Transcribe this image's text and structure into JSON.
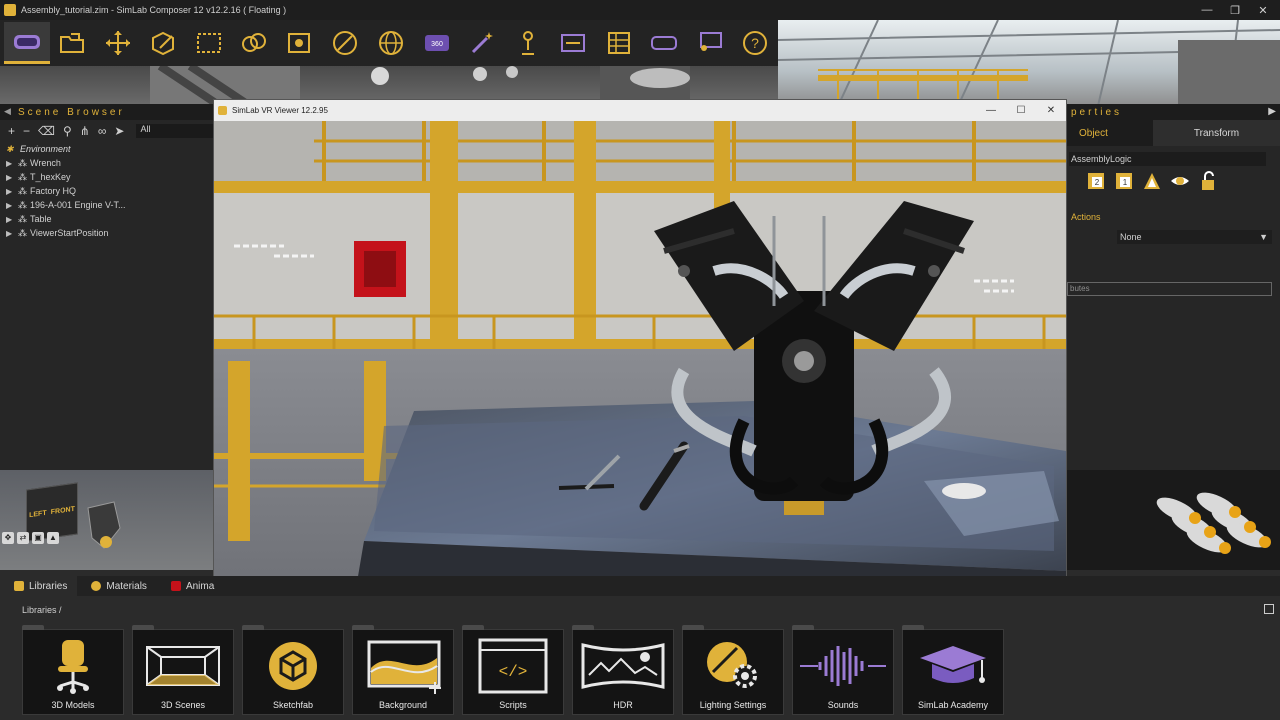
{
  "window": {
    "title": "Assembly_tutorial.zim - SimLab Composer 12 v12.2.16 ( Floating )",
    "controls": {
      "minimize": "—",
      "maximize": "❐",
      "close": "✕"
    }
  },
  "toolbar": {
    "tools": [
      "vr-headset-icon",
      "open-folder-icon",
      "move-icon",
      "edit-cube-icon",
      "selection-rect-icon",
      "pattern-icon",
      "camera-frame-icon",
      "material-icon",
      "globe-icon",
      "panorama-360-icon",
      "magic-wand-icon",
      "figure-icon",
      "sequence-icon",
      "grid-icon",
      "vr-goggles-icon",
      "presenter-icon",
      "help-icon"
    ]
  },
  "scene_browser": {
    "title": "Scene Browser",
    "filter": "All",
    "environment": "Environment",
    "items": [
      "Wrench",
      "T_hexKey",
      "Factory HQ",
      "196-A-001 Engine V-T...",
      "Table",
      "ViewerStartPosition"
    ],
    "cube_left": "LEFT",
    "cube_front": "FRONT"
  },
  "vr_viewer": {
    "title": "SimLab VR Viewer 12.2.95",
    "controls": {
      "minimize": "—",
      "maximize": "☐",
      "close": "✕"
    }
  },
  "properties": {
    "title": "perties",
    "tabs": [
      "Object",
      "Transform"
    ],
    "object_name": "AssemblyLogic",
    "actions_label": "Actions",
    "action_value": "None",
    "attributes_placeholder": "butes",
    "icons": [
      "number-2-icon",
      "number-1-icon",
      "triangle-icon",
      "eye-icon",
      "unlock-icon"
    ]
  },
  "libraries": {
    "tabs": [
      "Libraries",
      "Materials",
      "Anima"
    ],
    "breadcrumb": "Libraries  /",
    "items": [
      {
        "label": "3D Models",
        "icon": "chair-icon"
      },
      {
        "label": "3D Scenes",
        "icon": "room-icon"
      },
      {
        "label": "Sketchfab",
        "icon": "sketchfab-icon"
      },
      {
        "label": "Background",
        "icon": "background-icon"
      },
      {
        "label": "Scripts",
        "icon": "code-icon"
      },
      {
        "label": "HDR",
        "icon": "hdr-panorama-icon"
      },
      {
        "label": "Lighting Settings",
        "icon": "lighting-gear-icon"
      },
      {
        "label": "Sounds",
        "icon": "sound-wave-icon"
      },
      {
        "label": "SimLab Academy",
        "icon": "graduation-cap-icon"
      }
    ]
  },
  "colors": {
    "accent": "#e0b23a",
    "panel": "#262626",
    "dark": "#1c1c1c"
  }
}
